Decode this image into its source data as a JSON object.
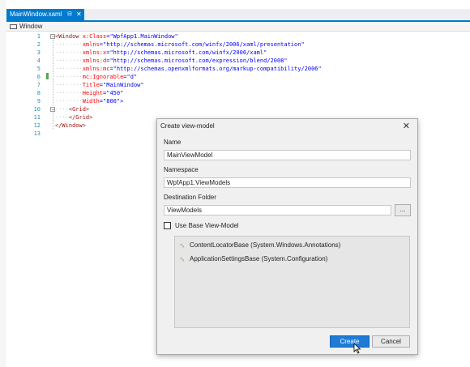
{
  "tab": {
    "title": "MainWindow.xaml",
    "pin": "⊟",
    "close": "✕"
  },
  "crumb": {
    "label": "Window"
  },
  "editor": {
    "lines": [
      {
        "n": "1",
        "segs": [
          [
            "tag",
            "<Window"
          ],
          [
            "attr",
            " x:Class"
          ],
          [
            "br",
            "="
          ],
          [
            "val",
            "\"WpfApp1.MainWindow\""
          ]
        ]
      },
      {
        "n": "2",
        "segs": [
          [
            "dots",
            "········"
          ],
          [
            "attr",
            "xmlns"
          ],
          [
            "br",
            "="
          ],
          [
            "val",
            "\"http://schemas.microsoft.com/winfx/2006/xaml/presentation\""
          ]
        ]
      },
      {
        "n": "3",
        "segs": [
          [
            "dots",
            "········"
          ],
          [
            "attr",
            "xmlns:x"
          ],
          [
            "br",
            "="
          ],
          [
            "val",
            "\"http://schemas.microsoft.com/winfx/2006/xaml\""
          ]
        ]
      },
      {
        "n": "4",
        "segs": [
          [
            "dots",
            "········"
          ],
          [
            "attr",
            "xmlns:d"
          ],
          [
            "br",
            "="
          ],
          [
            "val",
            "\"http://schemas.microsoft.com/expression/blend/2008\""
          ]
        ]
      },
      {
        "n": "5",
        "segs": [
          [
            "dots",
            "········"
          ],
          [
            "attr",
            "xmlns:mc"
          ],
          [
            "br",
            "="
          ],
          [
            "val",
            "\"http://schemas.openxmlformats.org/markup-compatibility/2006\""
          ]
        ]
      },
      {
        "n": "6",
        "segs": [
          [
            "dots",
            "········"
          ],
          [
            "attr",
            "mc:Ignorable"
          ],
          [
            "br",
            "="
          ],
          [
            "val",
            "\"d\""
          ]
        ]
      },
      {
        "n": "7",
        "segs": [
          [
            "dots",
            "········"
          ],
          [
            "attr",
            "Title"
          ],
          [
            "br",
            "="
          ],
          [
            "val",
            "\"MainWindow\""
          ]
        ]
      },
      {
        "n": "8",
        "segs": [
          [
            "dots",
            "········"
          ],
          [
            "attr",
            "Height"
          ],
          [
            "br",
            "="
          ],
          [
            "val",
            "\"450\""
          ]
        ]
      },
      {
        "n": "9",
        "segs": [
          [
            "dots",
            "········"
          ],
          [
            "attr",
            "Width"
          ],
          [
            "br",
            "="
          ],
          [
            "val",
            "\"800\">"
          ]
        ]
      },
      {
        "n": "10",
        "segs": [
          [
            "dots",
            "····"
          ],
          [
            "tag",
            "<Grid>"
          ]
        ]
      },
      {
        "n": "11",
        "segs": [
          [
            "dots",
            "····"
          ],
          [
            "tag",
            "</Grid>"
          ]
        ]
      },
      {
        "n": "12",
        "segs": [
          [
            "tag",
            "</Window>"
          ]
        ]
      },
      {
        "n": "13",
        "segs": []
      }
    ]
  },
  "dialog": {
    "title": "Create view-model",
    "close": "✕",
    "name_label": "Name",
    "name_value": "MainViewModel",
    "namespace_label": "Namespace",
    "namespace_value": "WpfApp1.ViewModels",
    "folder_label": "Destination Folder",
    "folder_value": "ViewModels",
    "browse": "...",
    "use_base_label": "Use Base View-Model",
    "base_items": [
      {
        "icon": "class-icon",
        "glyph": "⁴ₓ",
        "label": "ContentLocatorBase (System.Windows.Annotations)"
      },
      {
        "icon": "class-icon",
        "glyph": "⁴ₓ",
        "label": "ApplicationSettingsBase (System.Configuration)"
      }
    ],
    "create": "Create",
    "cancel": "Cancel"
  },
  "colors": {
    "accent": "#007acc",
    "tag": "#a31515",
    "attr": "#ff0000",
    "value": "#0000ff",
    "line_number": "#2b91af",
    "create_button": "#1e7bd6"
  }
}
